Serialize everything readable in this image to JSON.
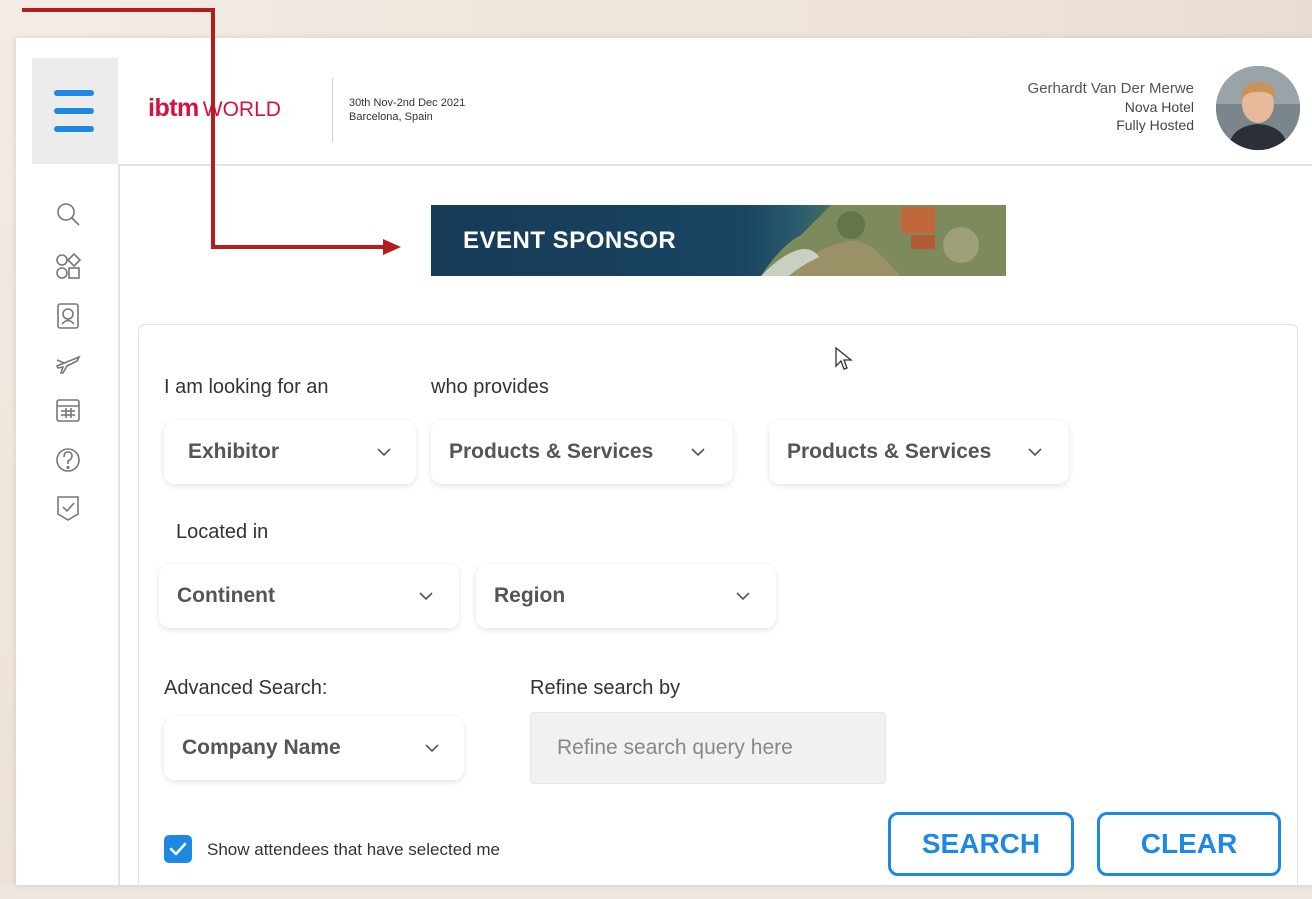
{
  "header": {
    "logo_bold": "ibtm",
    "logo_light": "WORLD",
    "event_dates": "30th Nov-2nd Dec 2021",
    "event_location": "Barcelona, Spain"
  },
  "user": {
    "name": "Gerhardt Van Der Merwe",
    "company": "Nova Hotel",
    "package": "Fully Hosted"
  },
  "banner": {
    "text": "EVENT SPONSOR"
  },
  "search": {
    "looking_for_label": "I am looking for an",
    "provides_label": "who provides",
    "type_value": "Exhibitor",
    "provides_value_1": "Products & Services",
    "provides_value_2": "Products & Services",
    "located_label": "Located in",
    "continent_value": "Continent",
    "region_value": "Region",
    "advanced_label": "Advanced Search:",
    "advanced_value": "Company Name",
    "refine_label": "Refine search by",
    "refine_placeholder": "Refine search query here",
    "checkbox_label": "Show attendees that have selected me",
    "checkbox_checked": true,
    "search_button": "SEARCH",
    "clear_button": "CLEAR"
  },
  "sidebar": {
    "icons": [
      "search-icon",
      "categories-icon",
      "profile-icon",
      "flight-icon",
      "calendar-icon",
      "help-icon",
      "checklist-icon"
    ]
  },
  "colors": {
    "accent": "#1e88e5",
    "brand": "#d4123f",
    "annotation": "#b71c1c"
  }
}
